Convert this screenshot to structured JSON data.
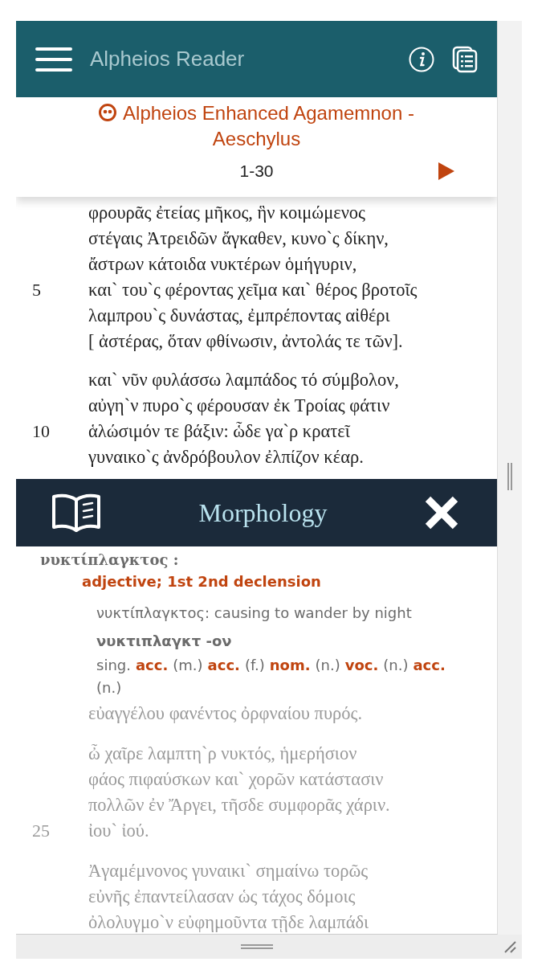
{
  "header": {
    "title": "Alpheios Reader"
  },
  "text_title": "Alpheios Enhanced Agamemnon - Aeschylus",
  "passage": {
    "range": "1-30"
  },
  "stanzas": [
    {
      "lines": [
        {
          "text": "φρουρᾶς ἐτείας μῆκος, ἣν κοιμώμενος"
        },
        {
          "text": "στέγαις Ἀτρειδῶν ἄγκαθεν, κυνο`ς δίκην,"
        },
        {
          "text": "ἄστρων κάτοιδα νυκτέρων ὁμήγυριν,"
        },
        {
          "number": "5",
          "text": "και` του`ς φέροντας χεῖμα και` θέρος βροτοῖς"
        },
        {
          "text": "λαμπρου`ς δυνάστας, ἐμπρέποντας αἰθέρι"
        },
        {
          "text": "[ ἀστέρας, ὅταν φθίνωσιν, ἀντολάς τε τῶν]."
        }
      ]
    },
    {
      "lines": [
        {
          "text": "και` νῦν φυλάσσω λαμπάδος τό σύμβολον,"
        },
        {
          "text": "αὐγη`ν πυρο`ς φέρουσαν ἐκ Τροίας φάτιν"
        },
        {
          "number": "10",
          "text": "ἁλώσιμόν τε βάξιν: ὧδε γα`ρ κρατεῖ"
        },
        {
          "text": "γυναικο`ς ἀνδρόβουλον ἐλπίζον κέαρ."
        }
      ]
    }
  ],
  "morphology": {
    "title": "Morphology",
    "lemma": "νυκτίπλαγκτος :",
    "part_of_speech": "adjective; 1st 2nd declension",
    "definition": "νυκτίπλαγκτος: causing to wander by night",
    "stem": "νυκτιπλαγκτ -ον",
    "number": "sing.",
    "forms": [
      {
        "case": "acc.",
        "gender": "(m.)"
      },
      {
        "case": "acc.",
        "gender": "(f.)"
      },
      {
        "case": "nom.",
        "gender": "(n.)"
      },
      {
        "case": "voc.",
        "gender": "(n.)"
      },
      {
        "case": "acc.",
        "gender": "(n.)"
      }
    ]
  },
  "faded_stanzas": [
    {
      "lines": [
        {
          "text": "εὐαγγέλου φανέντος ὀρφναίου πυρός."
        }
      ]
    },
    {
      "lines": [
        {
          "text": "ὦ χαῖρε λαμπτη`ρ νυκτός, ἡμερήσιον"
        },
        {
          "text": "φάος πιφαύσκων και` χορῶν κατάστασιν"
        },
        {
          "text": "πολλῶν ἐν Ἄργει, τῆσδε συμφορᾶς χάριν."
        },
        {
          "number": "25",
          "text": "ἰου` ἰού."
        }
      ]
    },
    {
      "lines": [
        {
          "text": "Ἀγαμέμνονος γυναικι` σημαίνω τορῶς"
        },
        {
          "text": "εὐνῆς ἐπαντείλασαν ὡς τάχος δόμοις"
        },
        {
          "text": "ὀλολυγμο`ν εὐφημοῦντα τῇδε λαμπάδι"
        }
      ]
    }
  ]
}
